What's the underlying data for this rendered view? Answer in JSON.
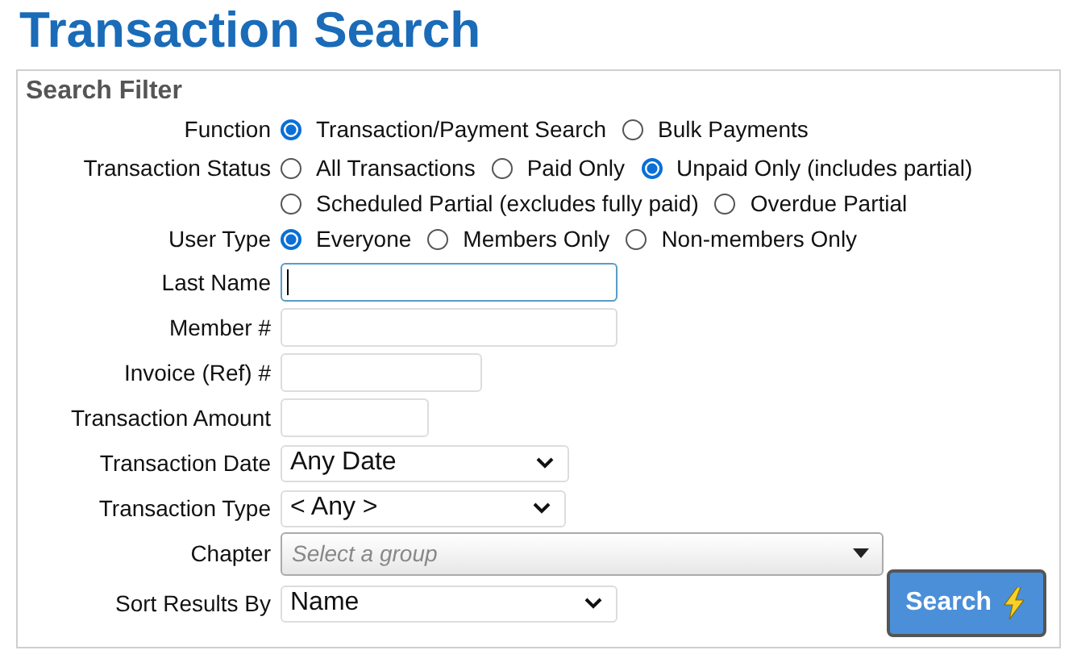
{
  "title": "Transaction Search",
  "filter": {
    "heading": "Search Filter",
    "fields": [
      {
        "kind": "radio",
        "label": "Function",
        "options": [
          {
            "label": "Transaction/Payment Search",
            "selected": true
          },
          {
            "label": "Bulk Payments",
            "selected": false
          }
        ]
      },
      {
        "kind": "radio",
        "label": "Transaction Status",
        "options": [
          {
            "label": "All Transactions",
            "selected": false
          },
          {
            "label": "Paid Only",
            "selected": false
          },
          {
            "label": "Unpaid Only (includes partial)",
            "selected": true
          },
          {
            "label": "Scheduled Partial (excludes fully paid)",
            "selected": false
          },
          {
            "label": "Overdue Partial",
            "selected": false
          }
        ]
      },
      {
        "kind": "radio",
        "label": "User Type",
        "options": [
          {
            "label": "Everyone",
            "selected": true
          },
          {
            "label": "Members Only",
            "selected": false
          },
          {
            "label": "Non-members Only",
            "selected": false
          }
        ]
      },
      {
        "kind": "text",
        "label": "Last Name",
        "focused": true
      },
      {
        "kind": "text",
        "label": "Member #",
        "focused": false
      },
      {
        "kind": "text",
        "label": "Invoice (Ref) #",
        "focused": false
      },
      {
        "kind": "text",
        "label": "Transaction Amount",
        "focused": false
      },
      {
        "kind": "select",
        "label": "Transaction Date",
        "value": "Any Date"
      },
      {
        "kind": "select",
        "label": "Transaction Type",
        "value": "< Any >"
      },
      {
        "kind": "combo",
        "label": "Chapter",
        "placeholder": "Select a group"
      },
      {
        "kind": "select",
        "label": "Sort Results By",
        "value": "Name",
        "button": "Search"
      }
    ]
  }
}
